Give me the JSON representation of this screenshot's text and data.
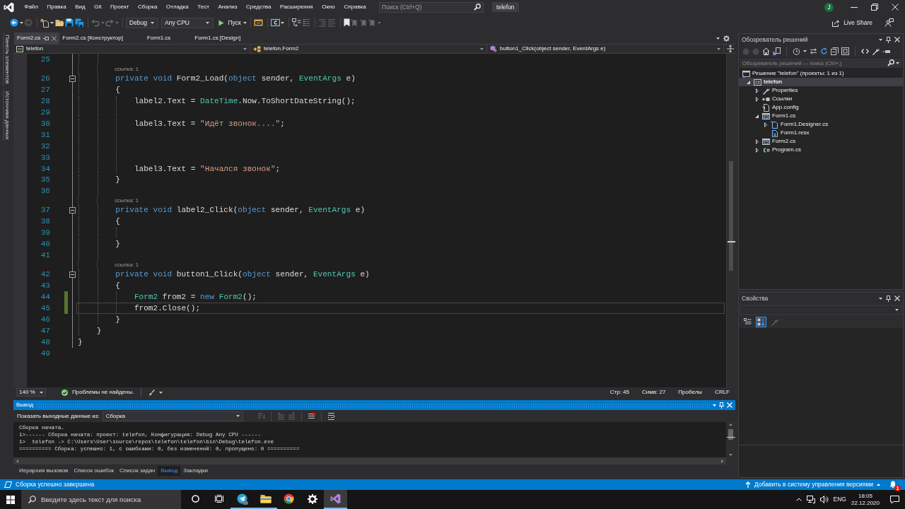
{
  "title_bar": {
    "menu": [
      "Файл",
      "Правка",
      "Вид",
      "Git",
      "Проект",
      "Сборка",
      "Отладка",
      "Тест",
      "Анализ",
      "Средства",
      "Расширения",
      "Окно",
      "Справка"
    ],
    "search": {
      "placeholder": "Поиск (Ctrl+Q)"
    },
    "solution_name": "telefon",
    "account_initial": "J"
  },
  "toolbar": {
    "configuration": "Debug",
    "platform": "Any CPU",
    "start": "Пуск",
    "live_share": "Live Share"
  },
  "side_tabs": [
    "Панель элементов",
    "Источники данных"
  ],
  "document_tabs": [
    {
      "label": "Form2.cs",
      "selected": true
    },
    {
      "label": "Form2.cs [Конструктор]",
      "selected": false
    },
    {
      "label": "Form1.cs",
      "selected": false
    },
    {
      "label": "Form1.cs [Design]",
      "selected": false
    }
  ],
  "navigation_bar": {
    "project": "telefon",
    "type": "telefon.Form2",
    "member": "button1_Click(object sender, EventArgs e)"
  },
  "editor": {
    "lines": [
      {
        "number": "25",
        "changed": false,
        "current": false
      },
      {
        "number": "26",
        "lens": "ссылка: 1",
        "expanded": true,
        "changed": false,
        "current": false,
        "tokens": [
          {
            "kind": "keyword",
            "text": "private void "
          },
          {
            "kind": "plain",
            "text": "Form2_Load("
          },
          {
            "kind": "keyword",
            "text": "object"
          },
          {
            "kind": "plain",
            "text": " sender, "
          },
          {
            "kind": "type",
            "text": "EventArgs"
          },
          {
            "kind": "plain",
            "text": " e)"
          }
        ]
      },
      {
        "number": "27",
        "changed": false,
        "current": false,
        "tokens": [
          {
            "kind": "plain",
            "text": "{"
          }
        ]
      },
      {
        "number": "28",
        "changed": false,
        "current": false,
        "tokens": [
          {
            "kind": "plain",
            "text": "label2.Text = "
          },
          {
            "kind": "type",
            "text": "DateTime"
          },
          {
            "kind": "plain",
            "text": ".Now.ToShortDateString();"
          }
        ]
      },
      {
        "number": "29",
        "changed": false,
        "current": false
      },
      {
        "number": "30",
        "changed": false,
        "current": false,
        "tokens": [
          {
            "kind": "plain",
            "text": "label3.Text = "
          },
          {
            "kind": "string",
            "text": "\"Идёт звонок....\""
          },
          {
            "kind": "plain",
            "text": ";"
          }
        ]
      },
      {
        "number": "31",
        "changed": false,
        "current": false
      },
      {
        "number": "32",
        "changed": false,
        "current": false
      },
      {
        "number": "33",
        "changed": false,
        "current": false
      },
      {
        "number": "34",
        "changed": false,
        "current": false,
        "tokens": [
          {
            "kind": "plain",
            "text": "label3.Text = "
          },
          {
            "kind": "string",
            "text": "\"Начался звонок\""
          },
          {
            "kind": "plain",
            "text": ";"
          }
        ]
      },
      {
        "number": "35",
        "changed": false,
        "current": false,
        "tokens": [
          {
            "kind": "plain",
            "text": "}"
          }
        ]
      },
      {
        "number": "36",
        "changed": false,
        "current": false
      },
      {
        "number": "37",
        "lens": "ссылка: 1",
        "expanded": true,
        "changed": false,
        "current": false,
        "tokens": [
          {
            "kind": "keyword",
            "text": "private void "
          },
          {
            "kind": "plain",
            "text": "label2_Click("
          },
          {
            "kind": "keyword",
            "text": "object"
          },
          {
            "kind": "plain",
            "text": " sender, "
          },
          {
            "kind": "type",
            "text": "EventArgs"
          },
          {
            "kind": "plain",
            "text": " e)"
          }
        ]
      },
      {
        "number": "38",
        "changed": false,
        "current": false,
        "tokens": [
          {
            "kind": "plain",
            "text": "{"
          }
        ]
      },
      {
        "number": "39",
        "changed": false,
        "current": false
      },
      {
        "number": "40",
        "changed": false,
        "current": false,
        "tokens": [
          {
            "kind": "plain",
            "text": "}"
          }
        ]
      },
      {
        "number": "41",
        "changed": false,
        "current": false
      },
      {
        "number": "42",
        "lens": "ссылка: 1",
        "expanded": true,
        "changed": false,
        "current": false,
        "tokens": [
          {
            "kind": "keyword",
            "text": "private void "
          },
          {
            "kind": "plain",
            "text": "button1_Click("
          },
          {
            "kind": "keyword",
            "text": "object"
          },
          {
            "kind": "plain",
            "text": " sender, "
          },
          {
            "kind": "type",
            "text": "EventArgs"
          },
          {
            "kind": "plain",
            "text": " e)"
          }
        ]
      },
      {
        "number": "43",
        "changed": false,
        "current": false,
        "tokens": [
          {
            "kind": "plain",
            "text": "{"
          }
        ]
      },
      {
        "number": "44",
        "changed": true,
        "current": false,
        "tokens": [
          {
            "kind": "type",
            "text": "Form2"
          },
          {
            "kind": "plain",
            "text": " from2 = "
          },
          {
            "kind": "keyword",
            "text": "new "
          },
          {
            "kind": "type",
            "text": "Form2"
          },
          {
            "kind": "plain",
            "text": "();"
          }
        ]
      },
      {
        "number": "45",
        "changed": true,
        "current": true,
        "tokens": [
          {
            "kind": "plain",
            "text": "from2.Close();"
          }
        ]
      },
      {
        "number": "46",
        "changed": false,
        "current": false,
        "tokens": [
          {
            "kind": "plain",
            "text": "}"
          }
        ]
      },
      {
        "number": "47",
        "changed": false,
        "current": false,
        "tokens": [
          {
            "kind": "plain",
            "text": "}"
          }
        ]
      },
      {
        "number": "48",
        "changed": false,
        "current": false,
        "tokens": [
          {
            "kind": "plain",
            "text": "}"
          }
        ]
      },
      {
        "number": "49",
        "changed": false,
        "current": false
      }
    ]
  },
  "editor_status": {
    "zoom": "140 %",
    "issues": "Проблемы не найдены.",
    "line": "Стр: 45",
    "column": "Симв: 27",
    "whitespace": "Пробелы",
    "line_ending": "CRLF"
  },
  "output": {
    "title": "Вывод",
    "source_label": "Показать выходные данные из:",
    "source": "Сборка",
    "lines": [
      "Сборка начата…",
      "1>------ Сборка начата: проект: telefon, Конфигурация: Debug Any CPU ------",
      "1>  telefon -> C:\\Users\\User\\source\\repos\\telefon\\telefon\\bin\\Debug\\telefon.exe",
      "========== Сборка: успешно: 1, с ошибками: 0, без изменений: 0, пропущено: 0 =========="
    ]
  },
  "bottom_tabs": [
    {
      "label": "Иерархия вызовов",
      "selected": false
    },
    {
      "label": "Список ошибок",
      "selected": false
    },
    {
      "label": "Список задач",
      "selected": false
    },
    {
      "label": "Вывод",
      "selected": true
    },
    {
      "label": "Закладки",
      "selected": false
    }
  ],
  "solution_explorer": {
    "title": "Обозреватель решений",
    "search": {
      "placeholder": "Обозреватель решений — поиск (Ctrl+;)"
    },
    "tree": [
      {
        "kind": "solution",
        "label": "Решение \"telefon\" (проекты: 1 из 1)",
        "selected": false,
        "children": [
          {
            "kind": "project",
            "label": "telefon",
            "expanded": true,
            "selected": true,
            "children": [
              {
                "kind": "properties",
                "label": "Properties",
                "expanded": false,
                "selected": false
              },
              {
                "kind": "references",
                "label": "Ссылки",
                "expanded": false,
                "selected": false
              },
              {
                "kind": "config",
                "label": "App.config",
                "selected": false
              },
              {
                "kind": "form",
                "label": "Form1.cs",
                "expanded": true,
                "selected": false,
                "children": [
                  {
                    "kind": "designer",
                    "label": "Form1.Designer.cs",
                    "expanded": false,
                    "selected": false
                  },
                  {
                    "kind": "resource",
                    "label": "Form1.resx",
                    "selected": false
                  }
                ]
              },
              {
                "kind": "form",
                "label": "Form2.cs",
                "expanded": false,
                "selected": false
              },
              {
                "kind": "class",
                "label": "Program.cs",
                "expanded": false,
                "selected": false
              }
            ]
          }
        ]
      }
    ]
  },
  "properties": {
    "title": "Свойства",
    "tools": [
      {
        "kind": "categorized",
        "selected": false
      },
      {
        "kind": "alphabetical",
        "selected": true
      },
      {
        "kind": "pages",
        "selected": false
      }
    ]
  },
  "status_bar": {
    "message": "Сборка успешно завершена",
    "source_control": "Добавить в систему управления версиями",
    "notifications": "1"
  },
  "taskbar": {
    "search": {
      "placeholder": "Введите здесь текст для поиска"
    },
    "apps": [
      {
        "kind": "cortana",
        "selected": false,
        "running": false
      },
      {
        "kind": "task_view",
        "selected": false,
        "running": false
      },
      {
        "kind": "telegram",
        "selected": false,
        "running": true
      },
      {
        "kind": "explorer",
        "selected": false,
        "running": true
      },
      {
        "kind": "chrome",
        "selected": false,
        "running": false
      },
      {
        "kind": "settings",
        "selected": false,
        "running": false
      },
      {
        "kind": "visual_studio",
        "selected": true,
        "running": true
      }
    ],
    "language": "ENG",
    "time": "18:05",
    "date": "22.12.2020"
  }
}
